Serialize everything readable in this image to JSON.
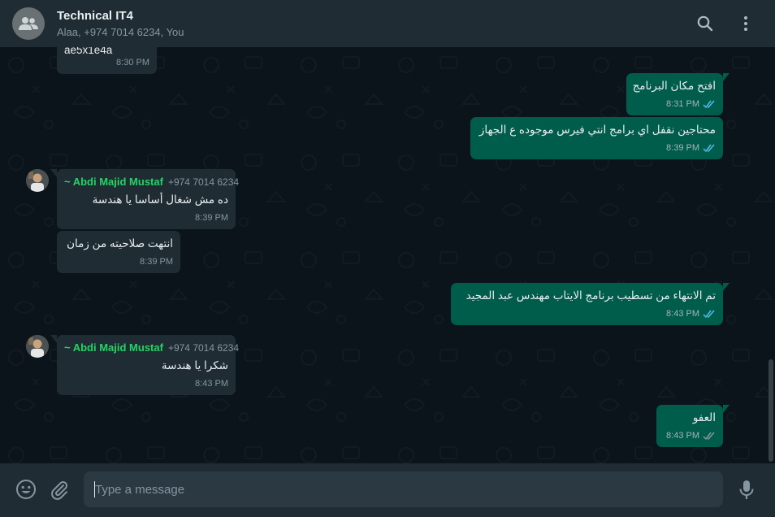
{
  "header": {
    "title": "Technical IT4",
    "members": "Alaa, +974 7014 6234, You",
    "icons": [
      "group-avatar-icon",
      "search-icon",
      "menu-icon"
    ]
  },
  "messages": [
    {
      "direction": "in",
      "text": "ae5x1e4a",
      "time": "8:30 PM"
    },
    {
      "direction": "out",
      "text": "افتح مكان البرنامج",
      "time": "8:31 PM",
      "status": "read"
    },
    {
      "direction": "out",
      "text": "محتاجين نقفل اي برامج انتي فيرس موجوده ع الجهاز",
      "time": "8:39 PM",
      "status": "read"
    },
    {
      "direction": "in",
      "sender": "~ Abdi Majid Mustaf",
      "phone": "+974 7014 6234",
      "text": "ده مش شغال أساسا يا هندسة",
      "time": "8:39 PM"
    },
    {
      "direction": "in",
      "text": "انتهت صلاحيته من زمان",
      "time": "8:39 PM"
    },
    {
      "direction": "out",
      "text": "تم الانتهاء من تسطيب برنامج الايتاب مهندس عبد المجيد",
      "time": "8:43 PM",
      "status": "read"
    },
    {
      "direction": "in",
      "sender": "~ Abdi Majid Mustaf",
      "phone": "+974 7014 6234",
      "text": "شكرا يا هندسة",
      "time": "8:43 PM"
    },
    {
      "direction": "out",
      "text": "العفو",
      "time": "8:43 PM",
      "status": "delivered"
    }
  ],
  "composer": {
    "placeholder": "Type a message",
    "value": "",
    "icons": [
      "emoji-icon",
      "attach-icon",
      "mic-icon"
    ]
  },
  "colors": {
    "header_bg": "#202c33",
    "chat_bg": "#0b141a",
    "outgoing_bubble": "#005c4b",
    "incoming_bubble": "#202c33",
    "sender_name": "#25d366",
    "read_tick": "#53bdeb",
    "delivered_tick": "#8696a0"
  }
}
